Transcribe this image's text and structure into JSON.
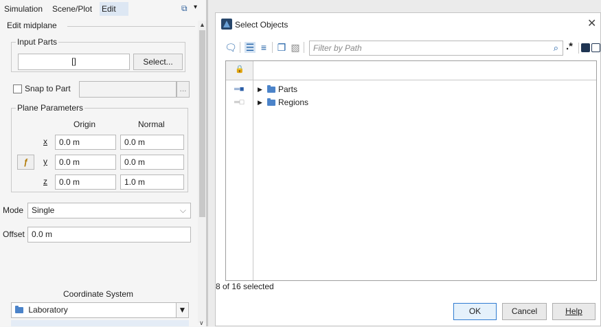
{
  "left_panel": {
    "tabs": [
      "Simulation",
      "Scene/Plot",
      "Edit"
    ],
    "edit_title": "Edit midplane",
    "input_parts": {
      "title": "Input Parts",
      "value": "[]",
      "select_label": "Select..."
    },
    "snap": {
      "label": "Snap to Part",
      "browse_label": "..."
    },
    "plane": {
      "title": "Plane Parameters",
      "origin_header": "Origin",
      "normal_header": "Normal",
      "rows": [
        {
          "axis": "x",
          "origin": "0.0 m",
          "normal": "0.0 m"
        },
        {
          "axis": "y",
          "origin": "0.0 m",
          "normal": "0.0 m"
        },
        {
          "axis": "z",
          "origin": "0.0 m",
          "normal": "1.0 m"
        }
      ]
    },
    "mode": {
      "label": "Mode",
      "value": "Single"
    },
    "offset": {
      "label": "Offset",
      "value": "0.0 m"
    },
    "coordinate": {
      "label": "Coordinate System",
      "value": "Laboratory"
    }
  },
  "dialog": {
    "title": "Select Objects",
    "filter_placeholder": "Filter by Path",
    "regex_label": ".*",
    "tree": [
      {
        "label": "Parts"
      },
      {
        "label": "Regions"
      }
    ],
    "status": "8 of 16 selected",
    "ok_label": "OK",
    "cancel_label": "Cancel",
    "help_label": "Help"
  },
  "colors": {
    "accent": "#dde7f3",
    "folder": "#4b83c9",
    "ok_border": "#2f7bd1"
  }
}
